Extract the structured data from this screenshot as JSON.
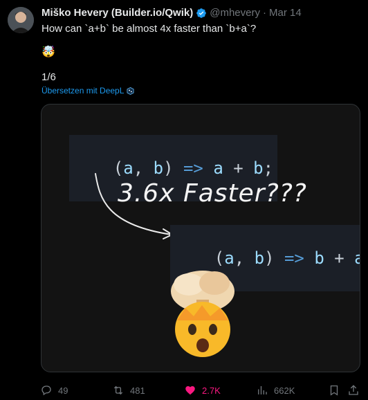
{
  "tweet": {
    "author_name": "Miško Hevery (Builder.io/Qwik)",
    "handle": "@mhevery",
    "separator": "·",
    "date": "Mar 14",
    "line1": "How can `a+b` be almost 4x faster than `b+a`?",
    "emoji": "🤯",
    "counter": "1/6",
    "translate_label": "Übersetzen mit DeepL"
  },
  "media": {
    "code_top": {
      "p1": "(",
      "a": "a",
      "comma": ",",
      "b": "b",
      "p2": ")",
      "arrow": "=>",
      "x": "a",
      "plus": "+",
      "y": "b",
      "semi": ";"
    },
    "headline": "3.6x Faster???",
    "code_bottom": {
      "p1": "(",
      "a": "a",
      "comma": ",",
      "b": "b",
      "p2": ")",
      "arrow": "=>",
      "x": "b",
      "plus": "+",
      "y": "a",
      "semi": ";"
    },
    "emoji": "🤯"
  },
  "actions": {
    "replies": "49",
    "retweets": "481",
    "likes": "2.7K",
    "views": "662K"
  },
  "colors": {
    "accent": "#1d9bf0",
    "like": "#f91880",
    "muted": "#71767b"
  }
}
